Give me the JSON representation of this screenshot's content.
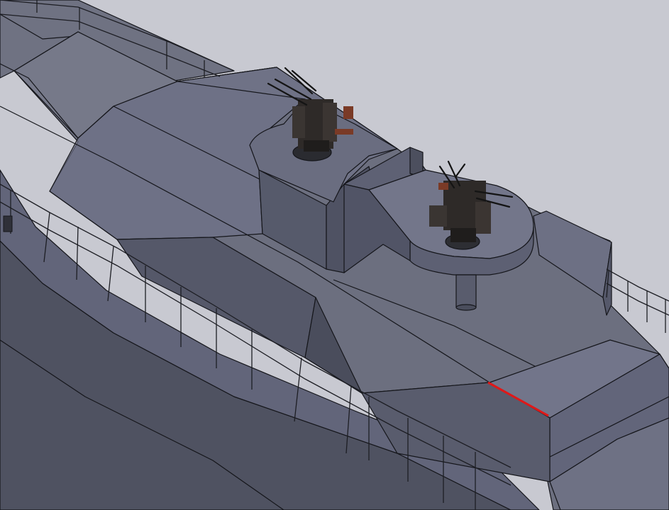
{
  "viewport": {
    "background_color": "#c8c9d1",
    "model": {
      "faces": {
        "deck_top": "#6d7080",
        "deck_light": "#7b7e8e",
        "hull_side": "#5d606f",
        "hull_dark": "#4c4f5d",
        "wall": "#55586a",
        "wall_light": "#686b7b",
        "edge": "#15161b"
      },
      "highlight_edge_color": "#e01818",
      "gun_color": "#2e2a28",
      "gun_accent": "#7a3a26",
      "components": [
        "hull",
        "main-deck",
        "conning-tower-platform",
        "forward-gun-tub",
        "aft-gun-platform",
        "platform-support-column",
        "deck-railings",
        "twin-aa-gun-forward",
        "quad-aa-gun-aft",
        "aft-deck-step"
      ]
    }
  }
}
